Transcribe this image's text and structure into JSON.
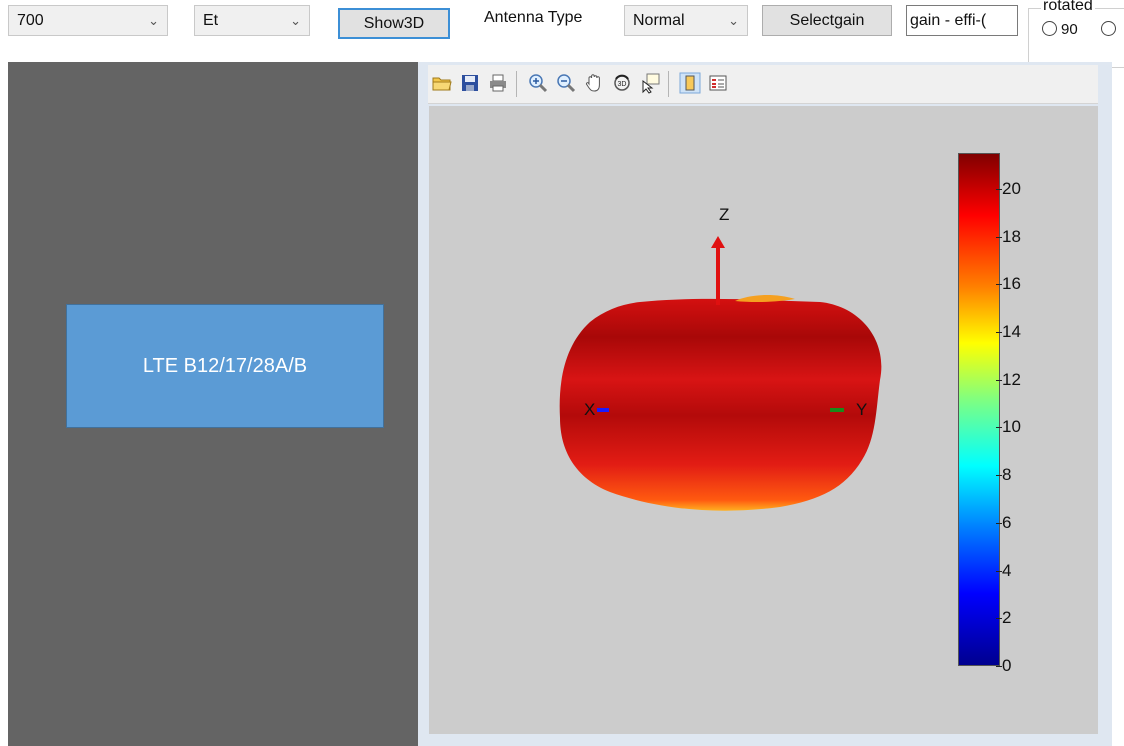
{
  "toolbar": {
    "frequency_select": "700",
    "field_select": "Et",
    "show3d_label": "Show3D",
    "antenna_type_label": "Antenna Type",
    "antenna_type_select": "Normal",
    "selectgain_label": "Selectgain",
    "gain_field_value": "gain - effi-(",
    "rotated_group_label": "rotated",
    "rotate_option_90": "90"
  },
  "band_label": "LTE B12/17/28A/B",
  "icons": [
    "open-icon",
    "save-icon",
    "print-icon",
    "zoom-in-icon",
    "zoom-out-icon",
    "pan-icon",
    "rotate-3d-icon",
    "data-cursor-icon",
    "colorbar-icon",
    "legend-icon"
  ],
  "axes": {
    "z_label": "Z",
    "x_label": "X",
    "y_label": "Y"
  },
  "chart_data": {
    "type": "heatmap",
    "title": "",
    "colormap": "jet",
    "clim": [
      0,
      21.5
    ],
    "colorbar_ticks": [
      0,
      2,
      4,
      6,
      8,
      10,
      12,
      14,
      16,
      18,
      20
    ],
    "axis_labels": [
      "X",
      "Y",
      "Z"
    ]
  },
  "colors": {
    "left_panel": "#646464",
    "band_box": "#5b9bd5",
    "axes_bg": "#cccccc"
  }
}
